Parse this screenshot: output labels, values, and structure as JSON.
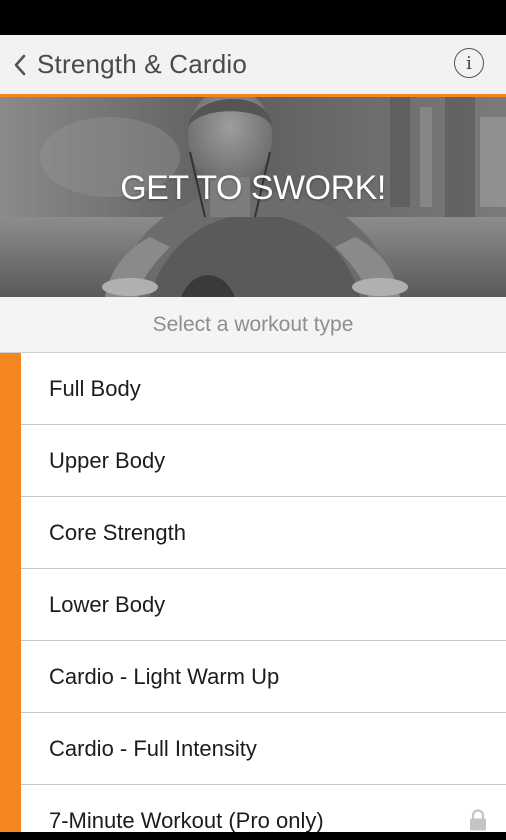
{
  "header": {
    "title": "Strength & Cardio",
    "back_icon": "chevron-left-icon",
    "info_icon": "info-icon",
    "info_glyph": "i",
    "accent_color": "#f5861f"
  },
  "hero": {
    "title": "GET TO SWORK!"
  },
  "list": {
    "header": "Select a workout type",
    "items": [
      {
        "label": "Full Body"
      },
      {
        "label": "Upper Body"
      },
      {
        "label": "Core Strength"
      },
      {
        "label": "Lower Body"
      },
      {
        "label": "Cardio - Light Warm Up"
      },
      {
        "label": "Cardio - Full Intensity"
      },
      {
        "label": "7-Minute Workout (Pro only)",
        "locked": true
      }
    ]
  }
}
